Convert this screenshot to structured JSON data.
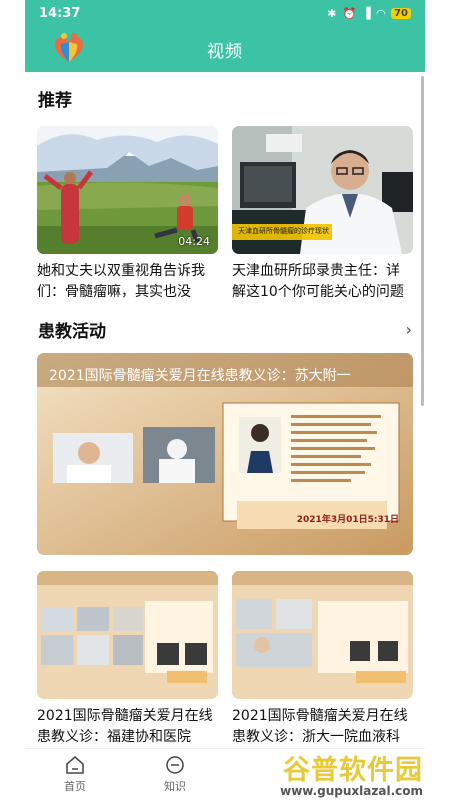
{
  "status": {
    "time": "14:37",
    "battery": "70"
  },
  "header": {
    "title": "视频"
  },
  "recommend": {
    "title": "推荐",
    "videos": [
      {
        "title": "她和丈夫以双重视角告诉我们：骨髓瘤嘛，其实也没那...",
        "duration": "04:24"
      },
      {
        "title": "天津血研所邱录贵主任：详解这10个你可能关心的问题",
        "overlay": "天津血研所骨髓瘤的诊疗现状"
      }
    ]
  },
  "activities": {
    "title": "患教活动",
    "banner": {
      "title": "2021国际骨髓瘤关爱月在线患教义诊：苏大附一",
      "date": "2021年3月01日5:31日"
    },
    "items": [
      {
        "title": "2021国际骨髓瘤关爱月在线患教义诊：福建协和医院"
      },
      {
        "title": "2021国际骨髓瘤关爱月在线患教义诊：浙大一院血液科"
      }
    ]
  },
  "tabbar": {
    "items": [
      {
        "label": "首页"
      },
      {
        "label": "知识"
      }
    ]
  },
  "watermark": {
    "text": "谷普软件园",
    "url": "www.gupuxlazal.com"
  },
  "colors": {
    "brand": "#3cc2a4"
  }
}
